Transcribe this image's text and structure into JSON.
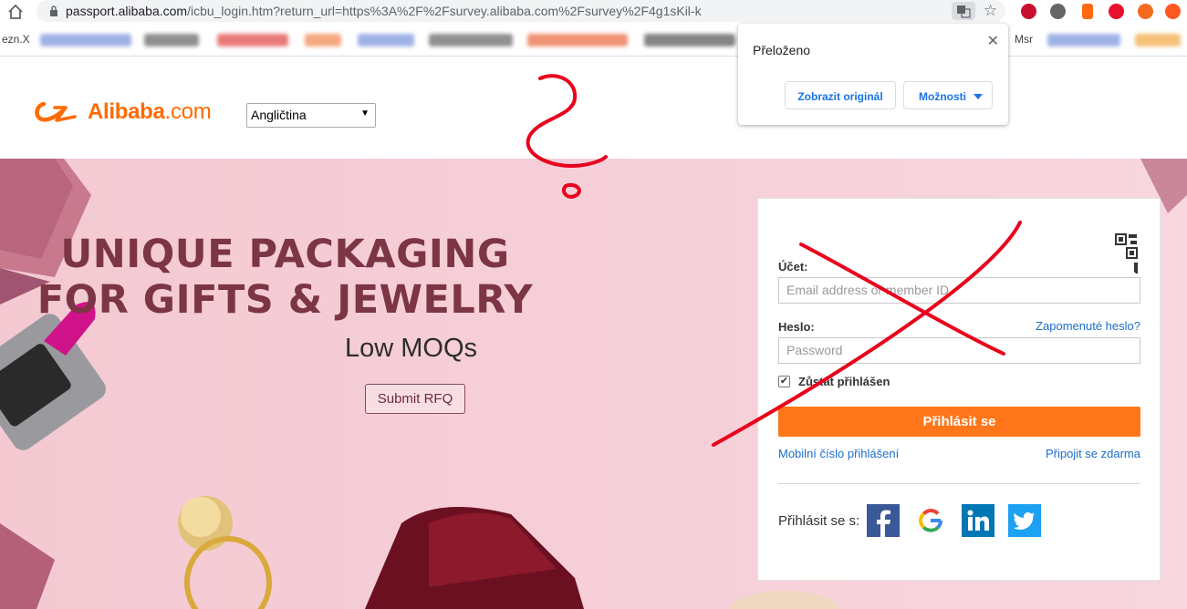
{
  "browser": {
    "url_host": "passport.alibaba.com",
    "url_path": "/icbu_login.htm?return_url=https%3A%2F%2Fsurvey.alibaba.com%2Fsurvey%2F4g1sKil-k",
    "bookmarks": {
      "first": "ezn.X",
      "last": "Msr"
    }
  },
  "translate_popup": {
    "title": "Přeloženo",
    "show_original": "Zobrazit originál",
    "options": "Možnosti"
  },
  "header": {
    "logo_bold": "Alibaba",
    "logo_suffix": ".com",
    "language": "Angličtina"
  },
  "banner": {
    "headline_1": "UNIQUE PACKAGING",
    "headline_2": "FOR GIFTS & JEWELRY",
    "subhead": "Low MOQs",
    "cta": "Submit RFQ"
  },
  "login": {
    "account_label": "Účet:",
    "account_placeholder": "Email address or member ID",
    "password_label": "Heslo:",
    "forgot_password": "Zapomenuté heslo?",
    "password_placeholder": "Password",
    "stay_signed_in": "Zůstat přihlášen",
    "sign_in_button": "Přihlásit se",
    "mobile_login": "Mobilní číslo přihlášení",
    "join_free": "Připojit se zdarma",
    "social_label": "Přihlásit se s:",
    "social_networks": [
      "facebook-icon",
      "google-icon",
      "linkedin-icon",
      "twitter-icon"
    ]
  },
  "colors": {
    "brand_orange": "#ff6a00",
    "button_orange": "#ff7519",
    "link_blue": "#1a6dcc",
    "annotation_red": "#e8001c",
    "headline": "#7c3544"
  }
}
